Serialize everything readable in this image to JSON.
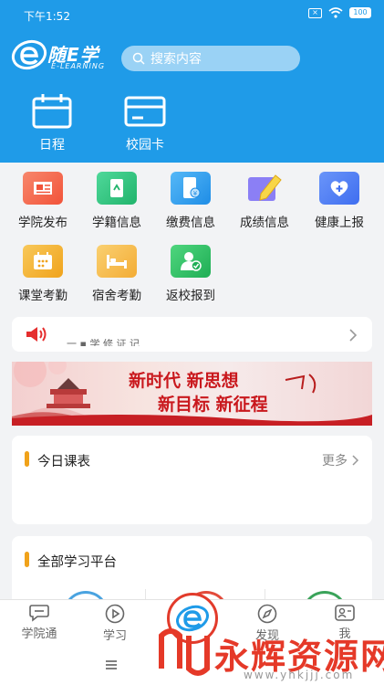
{
  "status_bar": {
    "time": "下午1:52",
    "battery": "100"
  },
  "header": {
    "logo_name": "随E学",
    "logo_sub": "E-LEARNING",
    "search_placeholder": "搜索内容",
    "buttons": [
      {
        "label": "日程",
        "icon": "calendar-icon"
      },
      {
        "label": "校园卡",
        "icon": "card-icon"
      }
    ]
  },
  "grid": [
    {
      "label": "学院发布",
      "icon": "news-icon",
      "color": "#f36b4f"
    },
    {
      "label": "学籍信息",
      "icon": "book-icon",
      "color": "#2ec27e"
    },
    {
      "label": "缴费信息",
      "icon": "phone-pay-icon",
      "color": "#2c9cf0"
    },
    {
      "label": "成绩信息",
      "icon": "pencil-icon",
      "color": "#7b6cf2"
    },
    {
      "label": "健康上报",
      "icon": "heart-shield-icon",
      "color": "#4f7cf4"
    },
    {
      "label": "课堂考勤",
      "icon": "calendar-check-icon",
      "color": "#f5b431"
    },
    {
      "label": "宿舍考勤",
      "icon": "bed-icon",
      "color": "#f5b94a"
    },
    {
      "label": "返校报到",
      "icon": "user-check-icon",
      "color": "#2dbd66"
    }
  ],
  "notice": {
    "text": "一 ▪ 学 修 证 记"
  },
  "banner": {
    "line1": "新时代 新思想",
    "line2": "新目标 新征程"
  },
  "today_class": {
    "title": "今日课表",
    "more": "更多"
  },
  "platforms": {
    "title": "全部学习平台"
  },
  "tabbar": {
    "tabs": [
      {
        "label": "学院通"
      },
      {
        "label": "学习"
      },
      {
        "label": "发现"
      },
      {
        "label": "我"
      }
    ]
  },
  "watermark": {
    "text": "永辉资源网",
    "url": "www.yhkjjj.com"
  }
}
